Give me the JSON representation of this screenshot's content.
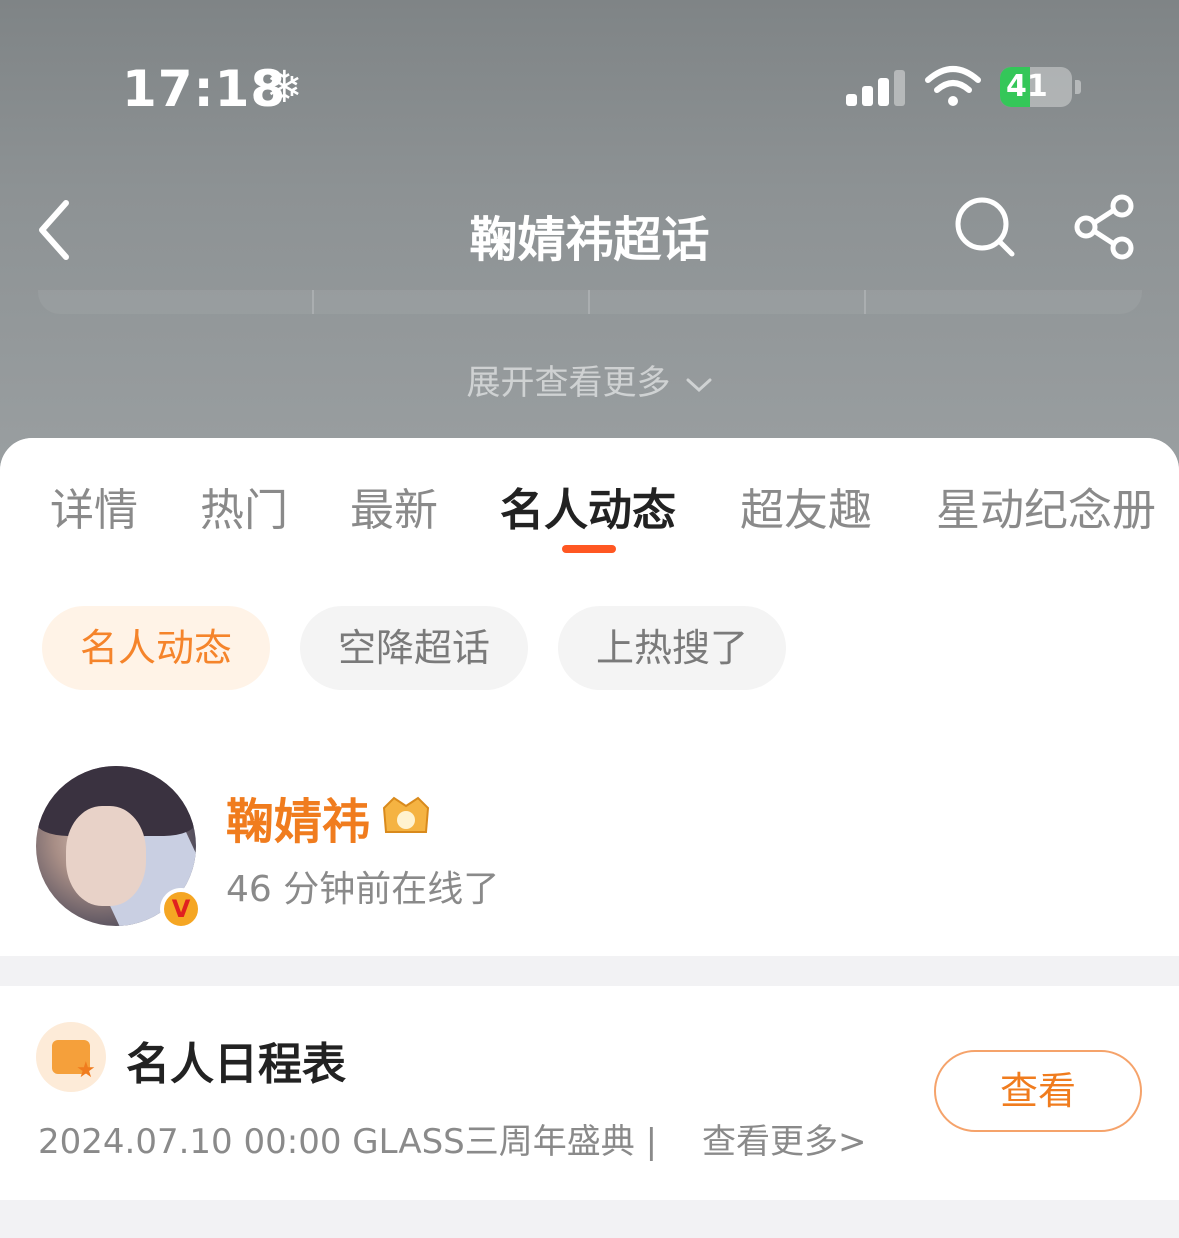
{
  "status_bar": {
    "time": "17:18",
    "battery": "41"
  },
  "nav": {
    "title": "鞠婧祎超话"
  },
  "expand_label": "展开查看更多",
  "tabs": [
    {
      "label": "详情"
    },
    {
      "label": "热门"
    },
    {
      "label": "最新"
    },
    {
      "label": "名人动态",
      "active": true
    },
    {
      "label": "超友趣"
    },
    {
      "label": "星动纪念册"
    }
  ],
  "chips": [
    {
      "label": "名人动态",
      "active": true
    },
    {
      "label": "空降超话"
    },
    {
      "label": "上热搜了"
    }
  ],
  "profile": {
    "name": "鞠婧祎",
    "status": "46 分钟前在线了",
    "badge": "V"
  },
  "schedule": {
    "title": "名人日程表",
    "info": "2024.07.10 00:00 GLASS三周年盛典 |",
    "more": "查看更多>",
    "button": "查看"
  },
  "colors": {
    "accent": "#ff5722",
    "orange_text": "#f07c1e",
    "battery_green": "#34c759"
  }
}
